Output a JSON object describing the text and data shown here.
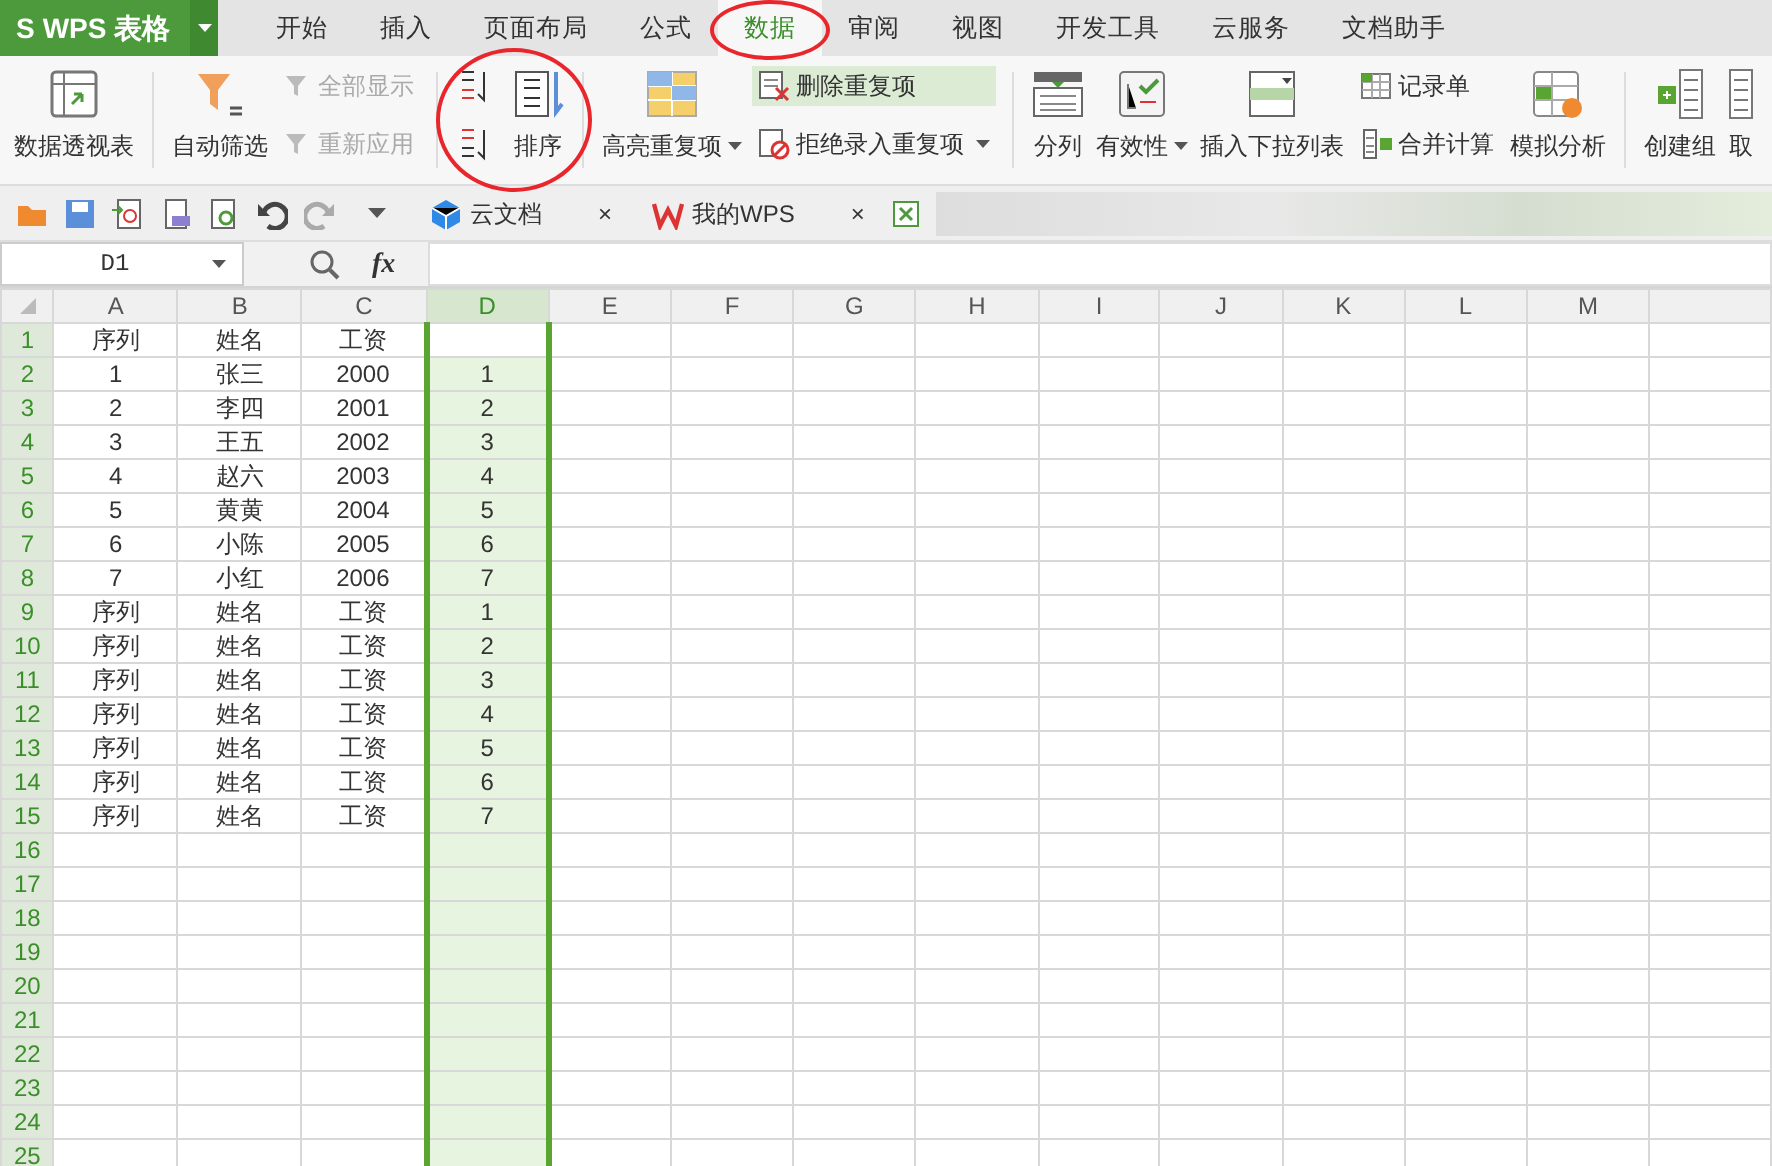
{
  "app": {
    "logo": "S",
    "title": "WPS 表格"
  },
  "menu_tabs": [
    {
      "label": "开始",
      "selected": false
    },
    {
      "label": "插入",
      "selected": false
    },
    {
      "label": "页面布局",
      "selected": false
    },
    {
      "label": "公式",
      "selected": false
    },
    {
      "label": "数据",
      "selected": true,
      "annotated": true
    },
    {
      "label": "审阅",
      "selected": false
    },
    {
      "label": "视图",
      "selected": false
    },
    {
      "label": "开发工具",
      "selected": false
    },
    {
      "label": "云服务",
      "selected": false
    },
    {
      "label": "文档助手",
      "selected": false
    }
  ],
  "ribbon": [
    {
      "kind": "large",
      "label": "数据透视表",
      "dropdown": false
    },
    {
      "kind": "separator"
    },
    {
      "kind": "large",
      "label": "自动筛选",
      "dropdown": false
    },
    {
      "kind": "stack",
      "items": [
        {
          "label": "全部显示",
          "disabled": true,
          "highlighted": false,
          "dropdown": false
        },
        {
          "label": "重新应用",
          "disabled": true,
          "highlighted": false,
          "dropdown": false
        }
      ]
    },
    {
      "kind": "separator"
    },
    {
      "kind": "sort-buttons",
      "annotated": true
    },
    {
      "kind": "large",
      "label": "排序",
      "dropdown": false
    },
    {
      "kind": "separator"
    },
    {
      "kind": "large",
      "label": "高亮重复项",
      "dropdown": true
    },
    {
      "kind": "stack",
      "items": [
        {
          "label": "删除重复项",
          "disabled": false,
          "highlighted": true,
          "dropdown": false
        },
        {
          "label": "拒绝录入重复项",
          "disabled": false,
          "highlighted": false,
          "dropdown": true
        }
      ]
    },
    {
      "kind": "separator"
    },
    {
      "kind": "large",
      "label": "分列",
      "dropdown": false
    },
    {
      "kind": "large",
      "label": "有效性",
      "dropdown": true
    },
    {
      "kind": "large",
      "label": "插入下拉列表",
      "dropdown": false
    },
    {
      "kind": "stack",
      "items": [
        {
          "label": "记录单",
          "disabled": false,
          "highlighted": false,
          "dropdown": false
        },
        {
          "label": "合并计算",
          "disabled": false,
          "highlighted": false,
          "dropdown": false
        }
      ]
    },
    {
      "kind": "large",
      "label": "模拟分析",
      "dropdown": false
    },
    {
      "kind": "separator"
    },
    {
      "kind": "large",
      "label": "创建组",
      "dropdown": false
    },
    {
      "kind": "large",
      "label": "取",
      "dropdown": false
    }
  ],
  "doc_tabs": [
    {
      "label": "云文档",
      "close": "×"
    },
    {
      "label": "我的WPS",
      "close": "×"
    }
  ],
  "formula_bar": {
    "name_box": "D1",
    "fx": "fx"
  },
  "sheet": {
    "columns": [
      {
        "label": "A",
        "selected": false
      },
      {
        "label": "B",
        "selected": false
      },
      {
        "label": "C",
        "selected": false
      },
      {
        "label": "D",
        "selected": true
      },
      {
        "label": "E",
        "selected": false
      },
      {
        "label": "F",
        "selected": false
      },
      {
        "label": "G",
        "selected": false
      },
      {
        "label": "H",
        "selected": false
      },
      {
        "label": "I",
        "selected": false
      },
      {
        "label": "J",
        "selected": false
      },
      {
        "label": "K",
        "selected": false
      },
      {
        "label": "L",
        "selected": false
      },
      {
        "label": "M",
        "selected": false
      }
    ],
    "rows": [
      {
        "label": "1",
        "cells": [
          "序列",
          "姓名",
          "工资",
          null
        ]
      },
      {
        "label": "2",
        "cells": [
          "1",
          "张三",
          "2000",
          "1"
        ]
      },
      {
        "label": "3",
        "cells": [
          "2",
          "李四",
          "2001",
          "2"
        ]
      },
      {
        "label": "4",
        "cells": [
          "3",
          "王五",
          "2002",
          "3"
        ]
      },
      {
        "label": "5",
        "cells": [
          "4",
          "赵六",
          "2003",
          "4"
        ]
      },
      {
        "label": "6",
        "cells": [
          "5",
          "黄黄",
          "2004",
          "5"
        ]
      },
      {
        "label": "7",
        "cells": [
          "6",
          "小陈",
          "2005",
          "6"
        ]
      },
      {
        "label": "8",
        "cells": [
          "7",
          "小红",
          "2006",
          "7"
        ]
      },
      {
        "label": "9",
        "cells": [
          "序列",
          "姓名",
          "工资",
          "1"
        ]
      },
      {
        "label": "10",
        "cells": [
          "序列",
          "姓名",
          "工资",
          "2"
        ]
      },
      {
        "label": "11",
        "cells": [
          "序列",
          "姓名",
          "工资",
          "3"
        ]
      },
      {
        "label": "12",
        "cells": [
          "序列",
          "姓名",
          "工资",
          "4"
        ]
      },
      {
        "label": "13",
        "cells": [
          "序列",
          "姓名",
          "工资",
          "5"
        ]
      },
      {
        "label": "14",
        "cells": [
          "序列",
          "姓名",
          "工资",
          "6"
        ]
      },
      {
        "label": "15",
        "cells": [
          "序列",
          "姓名",
          "工资",
          "7"
        ]
      },
      {
        "label": "16",
        "cells": []
      },
      {
        "label": "17",
        "cells": []
      },
      {
        "label": "18",
        "cells": []
      },
      {
        "label": "19",
        "cells": []
      },
      {
        "label": "20",
        "cells": []
      },
      {
        "label": "21",
        "cells": []
      },
      {
        "label": "22",
        "cells": []
      },
      {
        "label": "23",
        "cells": []
      },
      {
        "label": "24",
        "cells": []
      },
      {
        "label": "25",
        "cells": []
      }
    ]
  }
}
